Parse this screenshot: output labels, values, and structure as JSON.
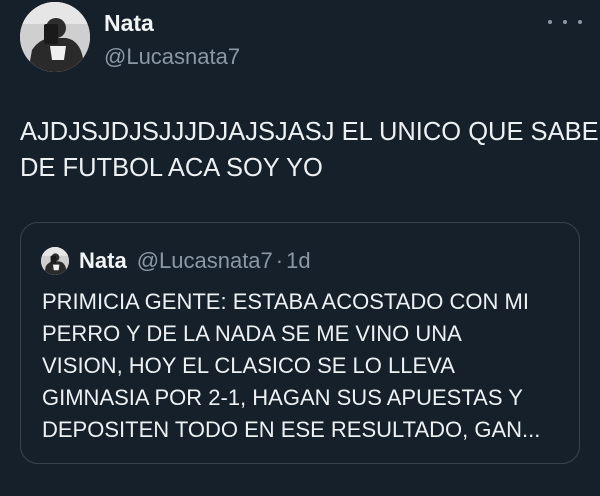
{
  "tweet": {
    "author": {
      "name": "Nata",
      "handle": "@Lucasnata7"
    },
    "text_lines": [
      "AJDJSJDJSJJJDJAJSJASJ EL UNICO QUE SABE",
      "DE FUTBOL ACA SOY YO"
    ]
  },
  "quote": {
    "author": {
      "name": "Nata",
      "handle": "@Lucasnata7"
    },
    "separator": "·",
    "time": "1d",
    "text_lines": [
      "PRIMICIA GENTE: ESTABA ACOSTADO CON MI",
      "PERRO Y DE LA NADA SE ME VINO UNA",
      "VISION, HOY EL CLASICO SE LO LLEVA",
      "GIMNASIA POR 2-1, HAGAN SUS APUESTAS Y",
      "DEPOSITEN TODO EN ESE RESULTADO, GAN..."
    ]
  },
  "icons": {
    "more": "more-horizontal-icon"
  },
  "colors": {
    "background": "#15202b",
    "text": "#e7e9ea",
    "secondary_text": "#8b98a5",
    "border": "#38444d"
  }
}
